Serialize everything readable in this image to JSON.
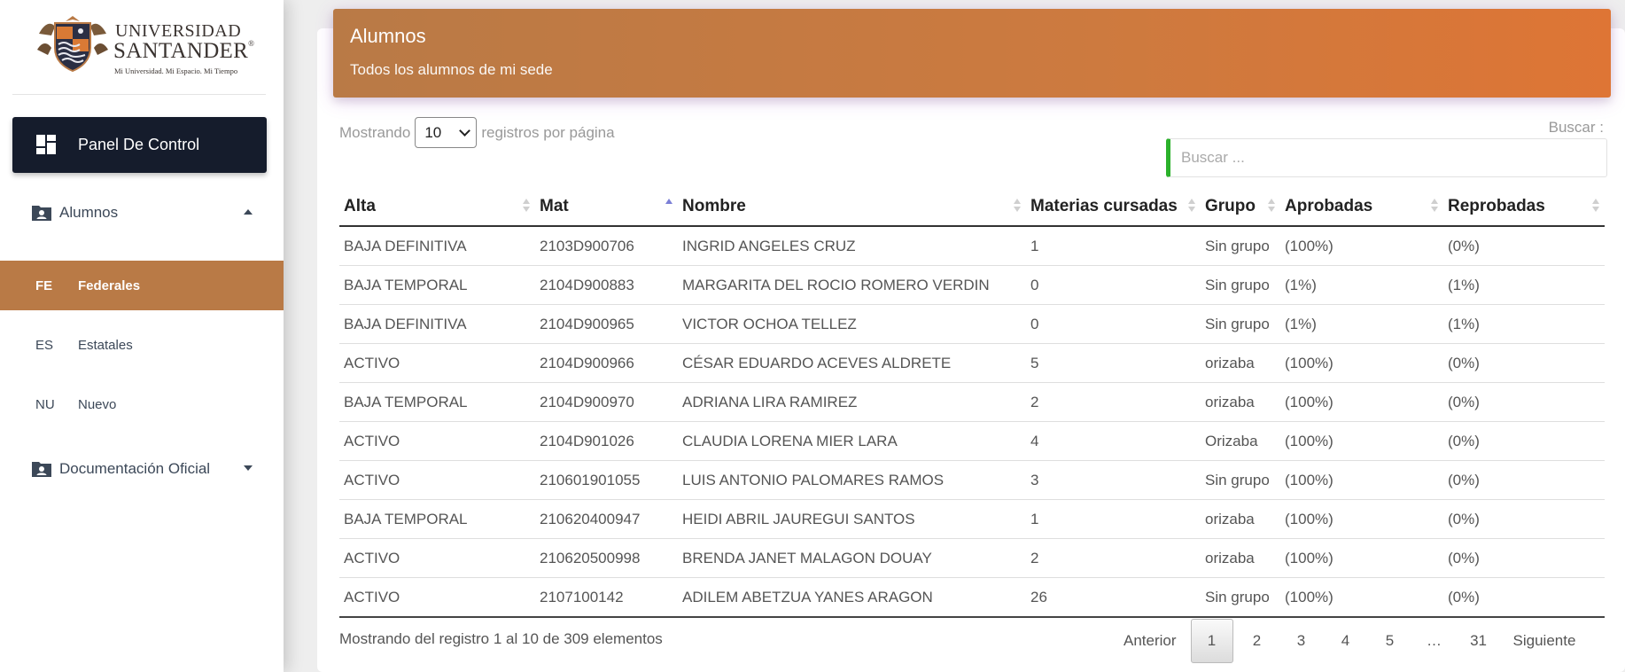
{
  "logo": {
    "line1": "UNIVERSIDAD",
    "line2": "SANTANDER",
    "registered": "®",
    "tagline": "Mi Universidad. Mi Espacio. Mi Tiempo"
  },
  "sidebar": {
    "panel_label": "Panel De Control",
    "groups": [
      {
        "label": "Alumnos",
        "icon": "folder-user-icon",
        "expanded": true
      },
      {
        "label": "Documentación Oficial",
        "icon": "folder-user-icon",
        "expanded": false
      }
    ],
    "subitems": [
      {
        "abbr": "FE",
        "label": "Federales",
        "active": true
      },
      {
        "abbr": "ES",
        "label": "Estatales",
        "active": false
      },
      {
        "abbr": "NU",
        "label": "Nuevo",
        "active": false
      }
    ]
  },
  "header": {
    "title": "Alumnos",
    "subtitle": "Todos los alumnos de mi sede"
  },
  "length_control": {
    "prefix": "Mostrando",
    "value": "10",
    "suffix": "registros por página"
  },
  "search": {
    "label": "Buscar :",
    "placeholder": "Buscar ..."
  },
  "table": {
    "columns": [
      "Alta",
      "Mat",
      "Nombre",
      "Materias cursadas",
      "Grupo",
      "Aprobadas",
      "Reprobadas"
    ],
    "sorted_column": "Mat",
    "rows": [
      {
        "alta": "BAJA DEFINITIVA",
        "mat": "2103D900706",
        "nombre": "INGRID ANGELES CRUZ",
        "materias": "1",
        "grupo": "Sin grupo",
        "aprobadas": "(100%)",
        "reprobadas": "(0%)"
      },
      {
        "alta": "BAJA TEMPORAL",
        "mat": "2104D900883",
        "nombre": "MARGARITA DEL ROCIO ROMERO VERDIN",
        "materias": "0",
        "grupo": "Sin grupo",
        "aprobadas": "(1%)",
        "reprobadas": "(1%)"
      },
      {
        "alta": "BAJA DEFINITIVA",
        "mat": "2104D900965",
        "nombre": "VICTOR OCHOA TELLEZ",
        "materias": "0",
        "grupo": "Sin grupo",
        "aprobadas": "(1%)",
        "reprobadas": "(1%)"
      },
      {
        "alta": "ACTIVO",
        "mat": "2104D900966",
        "nombre": "CÉSAR EDUARDO ACEVES ALDRETE",
        "materias": "5",
        "grupo": "orizaba",
        "aprobadas": "(100%)",
        "reprobadas": "(0%)"
      },
      {
        "alta": "BAJA TEMPORAL",
        "mat": "2104D900970",
        "nombre": "ADRIANA LIRA RAMIREZ",
        "materias": "2",
        "grupo": "orizaba",
        "aprobadas": "(100%)",
        "reprobadas": "(0%)"
      },
      {
        "alta": "ACTIVO",
        "mat": "2104D901026",
        "nombre": "CLAUDIA LORENA MIER LARA",
        "materias": "4",
        "grupo": "Orizaba",
        "aprobadas": "(100%)",
        "reprobadas": "(0%)"
      },
      {
        "alta": "ACTIVO",
        "mat": "210601901055",
        "nombre": "LUIS ANTONIO PALOMARES RAMOS",
        "materias": "3",
        "grupo": "Sin grupo",
        "aprobadas": "(100%)",
        "reprobadas": "(0%)"
      },
      {
        "alta": "BAJA TEMPORAL",
        "mat": "210620400947",
        "nombre": "HEIDI ABRIL JAUREGUI SANTOS",
        "materias": "1",
        "grupo": "orizaba",
        "aprobadas": "(100%)",
        "reprobadas": "(0%)"
      },
      {
        "alta": "ACTIVO",
        "mat": "210620500998",
        "nombre": "BRENDA JANET MALAGON DOUAY",
        "materias": "2",
        "grupo": "orizaba",
        "aprobadas": "(100%)",
        "reprobadas": "(0%)"
      },
      {
        "alta": "ACTIVO",
        "mat": "2107100142",
        "nombre": "ADILEM ABETZUA YANES ARAGON",
        "materias": "26",
        "grupo": "Sin grupo",
        "aprobadas": "(100%)",
        "reprobadas": "(0%)"
      }
    ]
  },
  "footer": {
    "info": "Mostrando del registro 1 al 10 de 309 elementos",
    "prev": "Anterior",
    "next": "Siguiente",
    "pages": [
      "1",
      "2",
      "3",
      "4",
      "5",
      "…",
      "31"
    ],
    "current_page": "1"
  },
  "colors": {
    "header_gradient_start": "#b97a46",
    "header_gradient_end": "#de7535",
    "sidebar_active": "#b97a46",
    "panel_bg": "#151c2c",
    "status_baja": "#e8464a",
    "status_activo": "#43a047",
    "name_link": "#c98454",
    "search_accent": "#2bb12b"
  }
}
